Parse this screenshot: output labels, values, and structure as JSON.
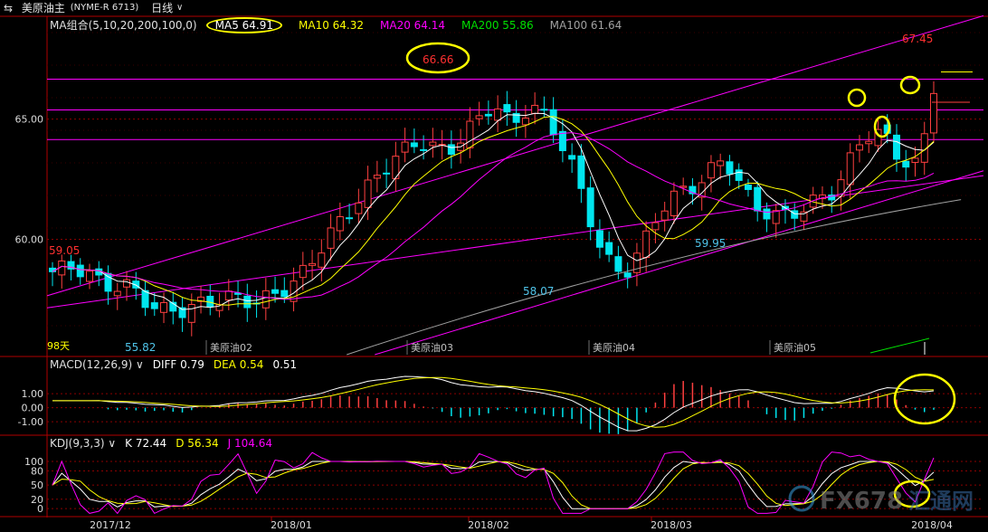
{
  "titlebar": {
    "icon": "switch-arrows-icon",
    "symbol": "美原油主",
    "code": "(NYME-R 6713)",
    "period": "日线"
  },
  "indicators": {
    "ma": {
      "name": "MA组合(5,10,20,200,100,0)",
      "items": [
        {
          "label": "MA5",
          "value": "64.91",
          "color": "#ffffff"
        },
        {
          "label": "MA10",
          "value": "64.32",
          "color": "#ffff00"
        },
        {
          "label": "MA20",
          "value": "64.14",
          "color": "#ff00ff"
        },
        {
          "label": "MA200",
          "value": "55.86",
          "color": "#00e000"
        },
        {
          "label": "MA100",
          "value": "61.64",
          "color": "#a0a0a0"
        }
      ]
    },
    "macd": {
      "name": "MACD(12,26,9)",
      "items": [
        {
          "label": "DIFF",
          "value": "0.79",
          "color": "#ffffff"
        },
        {
          "label": "DEA",
          "value": "0.54",
          "color": "#ffff00"
        },
        {
          "label": "",
          "value": "0.51",
          "color": "#ffffff"
        }
      ]
    },
    "kdj": {
      "name": "KDJ(9,3,3)",
      "items": [
        {
          "label": "K",
          "value": "72.44",
          "color": "#ffffff"
        },
        {
          "label": "D",
          "value": "56.34",
          "color": "#ffff00"
        },
        {
          "label": "J",
          "value": "104.64",
          "color": "#ff00ff"
        }
      ]
    }
  },
  "chart_data": [
    {
      "type": "candlestick",
      "panel": "price",
      "y_ticks": [
        60.0,
        65.0
      ],
      "y_tick_labels": [
        "60.00",
        "65.00"
      ],
      "ylim": [
        55.2,
        68.6
      ],
      "x_labels": [
        "2017/12",
        "2018/01",
        "2018/02",
        "2018/03",
        "2018/04"
      ],
      "contract_labels": [
        "美原油02",
        "美原油03",
        "美原油04",
        "美原油05"
      ],
      "annotations": [
        {
          "text": "66.66",
          "x": 3.35,
          "y": 66.66,
          "color": "#ff3030",
          "circled": true
        },
        {
          "text": "67.45",
          "x": 4.85,
          "y": 67.45,
          "color": "#ff3030",
          "circled": false
        },
        {
          "text": "59.05",
          "x": 0.0,
          "y": 59.05,
          "color": "#ff3030",
          "circled": false
        },
        {
          "text": "55.82",
          "x": 0.5,
          "y": 55.82,
          "color": "#4fc3e8",
          "circled": false
        },
        {
          "text": "58.07",
          "x": 2.7,
          "y": 58.07,
          "color": "#4fc3e8",
          "circled": false
        },
        {
          "text": "59.95",
          "x": 3.65,
          "y": 59.95,
          "color": "#4fc3e8",
          "circled": false
        }
      ],
      "days_label": "98天",
      "horizontal_lines": [
        66.66,
        65.38,
        64.15
      ],
      "trend_lines": [
        {
          "name": "upper",
          "from": [
            0.0,
            57.65
          ],
          "to": [
            5.0,
            69.3
          ]
        },
        {
          "name": "middle",
          "from": [
            0.0,
            57.15
          ],
          "to": [
            5.0,
            62.65
          ]
        },
        {
          "name": "lower",
          "from": [
            1.75,
            55.2
          ],
          "to": [
            5.0,
            62.85
          ]
        }
      ]
    },
    {
      "type": "macd",
      "panel": "macd",
      "y_ticks": [
        1.0,
        0.0,
        -1.0
      ],
      "y_tick_labels": [
        "1.00",
        "0.00",
        "-1.00"
      ],
      "ylim": [
        -1.9,
        2.5
      ]
    },
    {
      "type": "kdj",
      "panel": "kdj",
      "y_ticks": [
        100,
        80,
        50,
        20,
        0
      ],
      "y_tick_labels": [
        "100",
        "80",
        "50",
        "20",
        "0"
      ],
      "ylim": [
        -15,
        125
      ]
    }
  ],
  "watermark": {
    "text": "FX678",
    "suffix": "汇通网"
  },
  "colors": {
    "up": "#ff4040",
    "down": "#00e5ee",
    "magenta": "#ff00ff",
    "grid_red": "#8b0000",
    "axis_text": "#dcdcdc",
    "circle": "#ffff00"
  }
}
